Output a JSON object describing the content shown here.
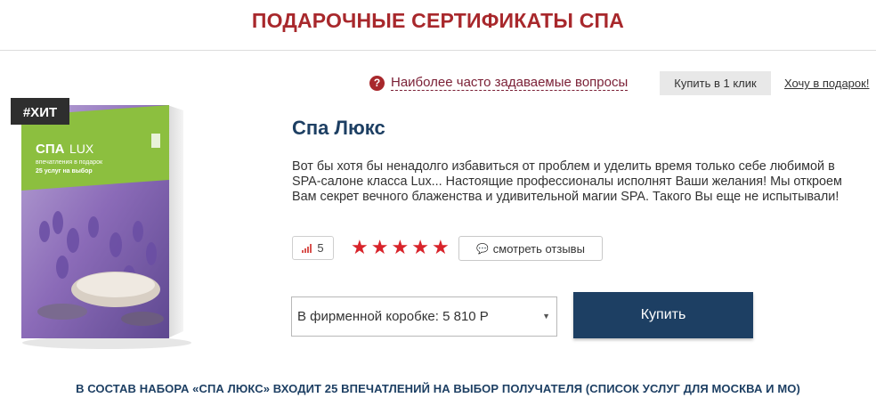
{
  "page": {
    "title": "ПОДАРОЧНЫЕ СЕРТИФИКАТЫ СПА"
  },
  "actions": {
    "faq_label": "Наиболее часто задаваемые вопросы",
    "faq_icon": "question-icon",
    "one_click_label": "Купить в 1 клик",
    "gift_label": "Хочу в подарок!"
  },
  "product_image": {
    "badge": "#ХИТ",
    "box_title_main": "СПА",
    "box_title_sub": "LUX",
    "box_subtitle_1": "впечатления в подарок",
    "box_subtitle_2": "25 услуг на выбор"
  },
  "product": {
    "name": "Спа Люкс",
    "description": "Вот бы хотя бы ненадолго избавиться от проблем и уделить время только себе любимой в SPA-салоне класса Lux... Настоящие профессионалы исполнят Ваши желания! Мы откроем Вам секрет вечного блаженства и удивительной магии SPA. Такого Вы еще не испытывали!",
    "rating_count": "5",
    "stars": 5,
    "reviews_label": "смотреть отзывы",
    "package_option": "В фирменной коробке: 5 810 Р",
    "buy_label": "Купить"
  },
  "set_heading": "В СОСТАВ НАБОРА «СПА ЛЮКС» ВХОДИТ 25 ВПЕЧАТЛЕНИЙ НА ВЫБОР ПОЛУЧАТЕЛЯ (СПИСОК УСЛУГ ДЛЯ МОСКВА И МО)",
  "colors": {
    "brand_red": "#a8282c",
    "navy": "#1d3f63",
    "star_red": "#d8232a",
    "box_green": "#8cbf3f",
    "lavender": "#8b6bb8"
  }
}
